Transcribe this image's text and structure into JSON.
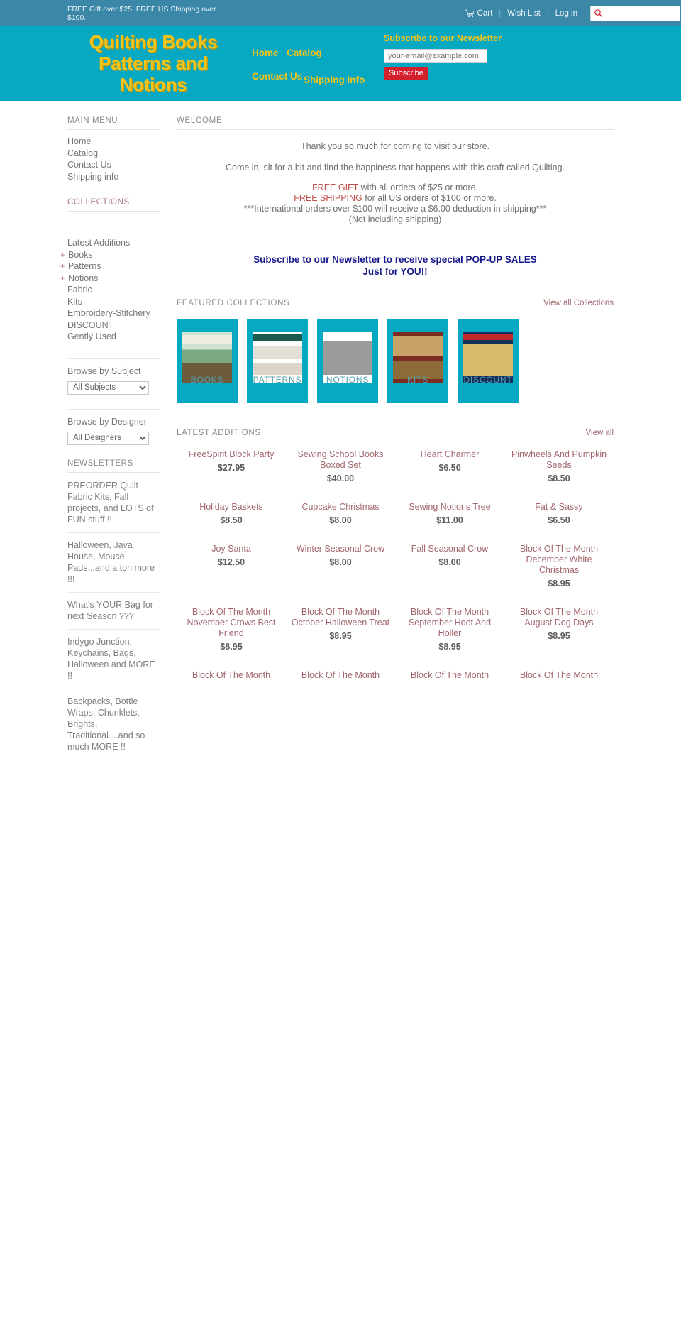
{
  "topbar": {
    "promo": "FREE Gift over $25. FREE US Shipping over $100.",
    "cart": "Cart",
    "wishlist": "Wish List",
    "login": "Log in",
    "search_placeholder": ""
  },
  "header": {
    "logo": "Quilting Books Patterns and Notions",
    "nav": [
      "Home",
      "Catalog",
      "Contact Us"
    ],
    "nav_row2": "Shipping info",
    "newsletter_title": "Subscribe to our Newsletter",
    "newsletter_placeholder": "your-email@example.com",
    "subscribe_label": "Subscribe"
  },
  "sidebar": {
    "main_menu_title": "MAIN MENU",
    "main_menu": [
      "Home",
      "Catalog",
      "Contact Us",
      "Shipping info"
    ],
    "collections_title": "COLLECTIONS",
    "collections": [
      {
        "label": "Latest Additions",
        "expandable": false
      },
      {
        "label": "Books",
        "expandable": true
      },
      {
        "label": "Patterns",
        "expandable": true
      },
      {
        "label": "Notions",
        "expandable": true
      },
      {
        "label": "Fabric",
        "expandable": false
      },
      {
        "label": "Kits",
        "expandable": false
      },
      {
        "label": "Embroidery-Stitchery",
        "expandable": false
      },
      {
        "label": "DISCOUNT",
        "expandable": false
      },
      {
        "label": "Gently Used",
        "expandable": false
      }
    ],
    "browse_subject_label": "Browse by Subject",
    "browse_subject_value": "All Subjects",
    "browse_designer_label": "Browse by Designer",
    "browse_designer_value": "All Designers",
    "newsletters_title": "NEWSLETTERS",
    "newsletters": [
      "PREORDER Quilt Fabric Kits, Fall projects, and LOTS of FUN stuff !!",
      "Halloween, Java House, Mouse Pads...and a ton more !!!",
      "What's YOUR Bag for next Season ???",
      "Indygo Junction, Keychains, Bags, Halloween and MORE !!",
      "Backpacks, Bottle Wraps, Chunklets, Brights, Traditional....and so much MORE !!"
    ]
  },
  "welcome": {
    "title": "WELCOME",
    "line1": "Thank you so much for coming to visit our store.",
    "line2": "Come in, sit for a bit and find the happiness that happens with this craft called Quilting.",
    "promo1_red": "FREE GIFT",
    "promo1_rest": " with all orders of $25 or more.",
    "promo2_red": "FREE SHIPPING",
    "promo2_rest": " for all US orders of $100 or more.",
    "promo3": "***International orders over $100 will receive a $6.00 deduction in shipping***",
    "promo4": "(Not including shipping)",
    "popup1": "Subscribe to our Newsletter to receive special POP-UP SALES",
    "popup2": "Just for YOU!!"
  },
  "featured": {
    "title": "FEATURED COLLECTIONS",
    "view_all": "View all Collections",
    "items": [
      {
        "label": "BOOKS"
      },
      {
        "label": "PATTERNS"
      },
      {
        "label": "NOTIONS"
      },
      {
        "label": "KITS"
      },
      {
        "label": "DISCOUNT"
      }
    ]
  },
  "latest": {
    "title": "LATEST ADDITIONS",
    "view_all": "View all",
    "products": [
      {
        "title": "FreeSpirit Block Party",
        "price": "$27.95"
      },
      {
        "title": "Sewing School Books Boxed Set",
        "price": "$40.00"
      },
      {
        "title": "Heart Charmer",
        "price": "$6.50"
      },
      {
        "title": "Pinwheels And Pumpkin Seeds",
        "price": "$8.50"
      },
      {
        "title": "Holiday Baskets",
        "price": "$8.50"
      },
      {
        "title": "Cupcake Christmas",
        "price": "$8.00"
      },
      {
        "title": "Sewing Notions Tree",
        "price": "$11.00"
      },
      {
        "title": "Fat & Sassy",
        "price": "$6.50"
      },
      {
        "title": "Joy Santa",
        "price": "$12.50"
      },
      {
        "title": "Winter Seasonal Crow",
        "price": "$8.00"
      },
      {
        "title": "Fall Seasonal Crow",
        "price": "$8.00"
      },
      {
        "title": "Block Of The Month December White Christmas",
        "price": "$8.95"
      },
      {
        "title": "Block Of The Month November Crows Best Friend",
        "price": "$8.95"
      },
      {
        "title": "Block Of The Month October Halloween Treat",
        "price": "$8.95"
      },
      {
        "title": "Block Of The Month September Hoot And Holler",
        "price": "$8.95"
      },
      {
        "title": "Block Of The Month August Dog Days",
        "price": "$8.95"
      },
      {
        "title": "Block Of The Month",
        "price": ""
      },
      {
        "title": "Block Of The Month",
        "price": ""
      },
      {
        "title": "Block Of The Month",
        "price": ""
      },
      {
        "title": "Block Of The Month",
        "price": ""
      }
    ]
  },
  "colors": {
    "teal": "#07a9c2",
    "topbar_teal": "#3a87a8",
    "logo_yellow": "#f3c41a",
    "subscribe_red": "#d4202d",
    "link_mauve": "#a1666d",
    "popup_navy": "#1a1a8c"
  }
}
